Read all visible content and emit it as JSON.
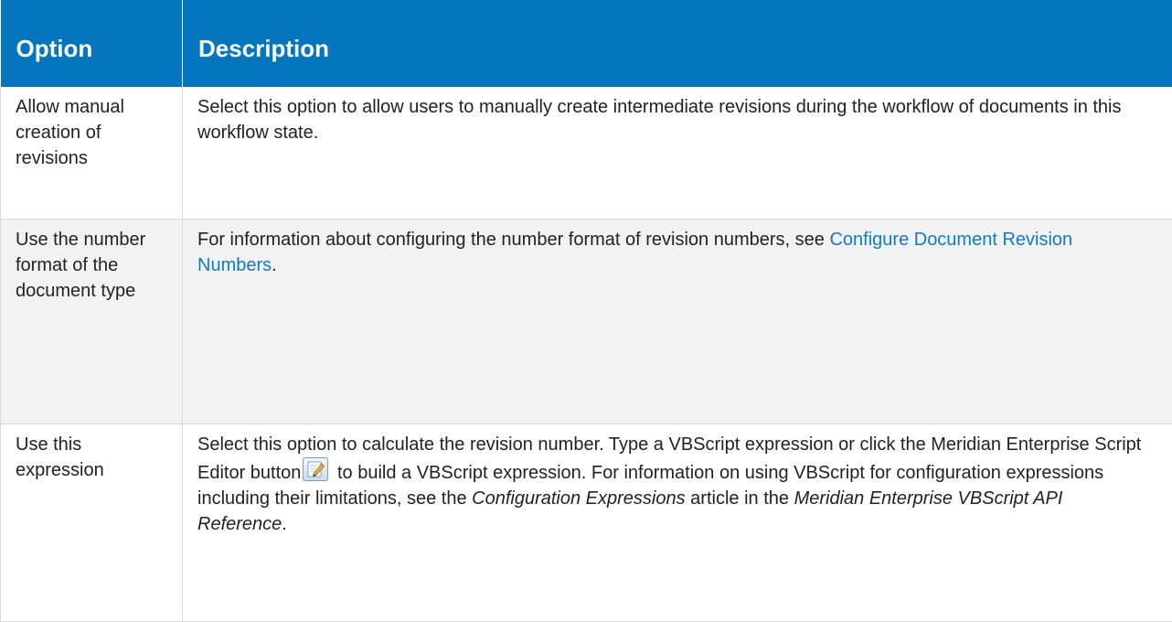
{
  "table": {
    "headers": {
      "option": "Option",
      "description": "Description"
    },
    "rows": [
      {
        "option": "Allow manual creation of revisions",
        "description": "Select this option to allow users to manually create intermediate revisions during the workflow of documents in this workflow state."
      },
      {
        "option": "Use the number format of the document type",
        "description_text": "For information about configuring the number format of revision numbers, see ",
        "description_link": "Configure Document Revision Numbers",
        "description_end": "."
      },
      {
        "option": "Use this expression",
        "desc_part1": "Select this option to calculate the revision number. Type a VBScript expression or click the Meridian Enterprise Script Editor button",
        "desc_part2": " to build a VBScript expression.  For information on using VBScript for configuration expressions including their limitations, see the ",
        "desc_italic1": "Configuration Expressions",
        "desc_part3": " article in the ",
        "desc_italic2": "Meridian Enterprise VBScript API Reference",
        "desc_part4": "."
      }
    ]
  },
  "icons": {
    "script_editor_button": "script-editor-icon"
  },
  "colors": {
    "header_bg": "#0476c0",
    "link": "#0c7bd0",
    "alt_row": "#f2f2f2"
  }
}
